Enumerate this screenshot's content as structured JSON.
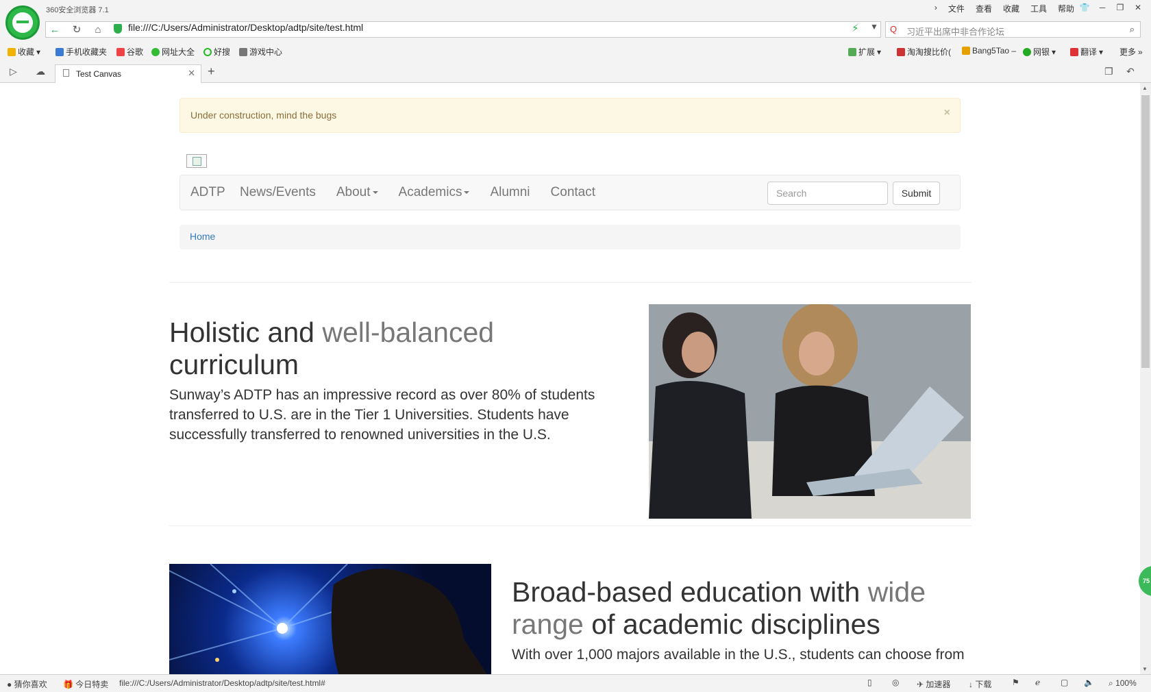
{
  "browser": {
    "window_title": "360安全浏览器 7.1",
    "menu": [
      "文件",
      "查看",
      "收藏",
      "工具",
      "帮助"
    ],
    "address": "file:///C:/Users/Administrator/Desktop/adtp/site/test.html",
    "search_placeholder": "习近平出席中非合作论坛",
    "bookmarks_left": [
      "收藏",
      "手机收藏夹",
      "谷歌",
      "网址大全",
      "好搜",
      "游戏中心"
    ],
    "bookmarks_right": [
      "扩展",
      "淘淘搜比价(",
      "Bang5Tao –",
      "网银",
      "翻译",
      "更多"
    ],
    "tab": {
      "title": "Test Canvas"
    },
    "side_badge": "75",
    "status": {
      "left_items": [
        "猜你喜欢",
        "今日特卖"
      ],
      "link_url": "file:///C:/Users/Administrator/Desktop/adtp/site/test.html#",
      "accelerator": "加速器",
      "download": "下载",
      "zoom": "100%"
    }
  },
  "page": {
    "alert": {
      "text": "Under construction, mind the bugs",
      "close": "×"
    },
    "navbar": {
      "brand": "ADTP",
      "items": [
        {
          "label": "News/Events"
        },
        {
          "label": "About"
        },
        {
          "label": "Academics"
        },
        {
          "label": "Alumni"
        },
        {
          "label": "Contact"
        }
      ],
      "search_placeholder": "Search",
      "submit_label": "Submit"
    },
    "breadcrumb": "Home",
    "feature1": {
      "heading_main": "Holistic and",
      "heading_muted": "well-balanced",
      "heading_end": "curriculum",
      "lead": "Sunway’s ADTP has an impressive record as over 80% of students transferred to U.S. are in the Tier 1 Universities. Students have successfully transferred to renowned universities in the U.S."
    },
    "feature2": {
      "heading_main": "Broad-based education with",
      "heading_muted": "wide range",
      "heading_end": "of academic disciplines",
      "lead": "With over 1,000 majors available in the U.S., students can choose from"
    }
  }
}
